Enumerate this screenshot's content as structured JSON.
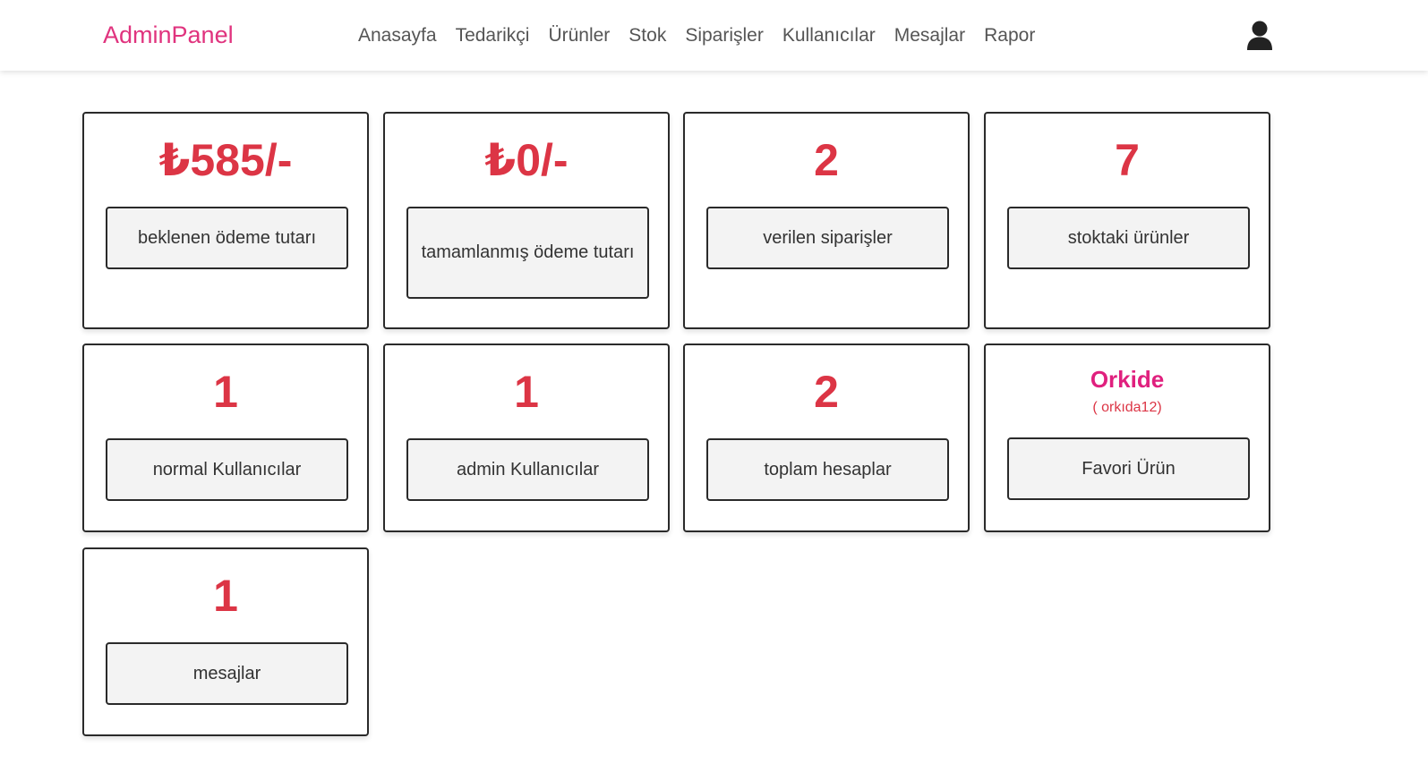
{
  "header": {
    "logo": "AdminPanel",
    "nav": [
      "Anasayfa",
      "Tedarikçi",
      "Ürünler",
      "Stok",
      "Siparişler",
      "Kullanıcılar",
      "Mesajlar",
      "Rapor"
    ]
  },
  "colors": {
    "accent": "#e0337e",
    "value": "#dc3545",
    "favorite": "#e0207e"
  },
  "cards": [
    {
      "value": "₺585/-",
      "label": "beklenen ödeme tutarı"
    },
    {
      "value": "₺0/-",
      "label": "tamamlanmış ödeme tutarı"
    },
    {
      "value": "2",
      "label": "verilen siparişler"
    },
    {
      "value": "7",
      "label": "stoktaki ürünler"
    },
    {
      "value": "1",
      "label": "normal Kullanıcılar"
    },
    {
      "value": "1",
      "label": "admin Kullanıcılar"
    },
    {
      "value": "2",
      "label": "toplam hesaplar"
    },
    {
      "name": "Orkide",
      "sub": "( orkıda12)",
      "label": "Favori Ürün"
    },
    {
      "value": "1",
      "label": "mesajlar"
    }
  ]
}
